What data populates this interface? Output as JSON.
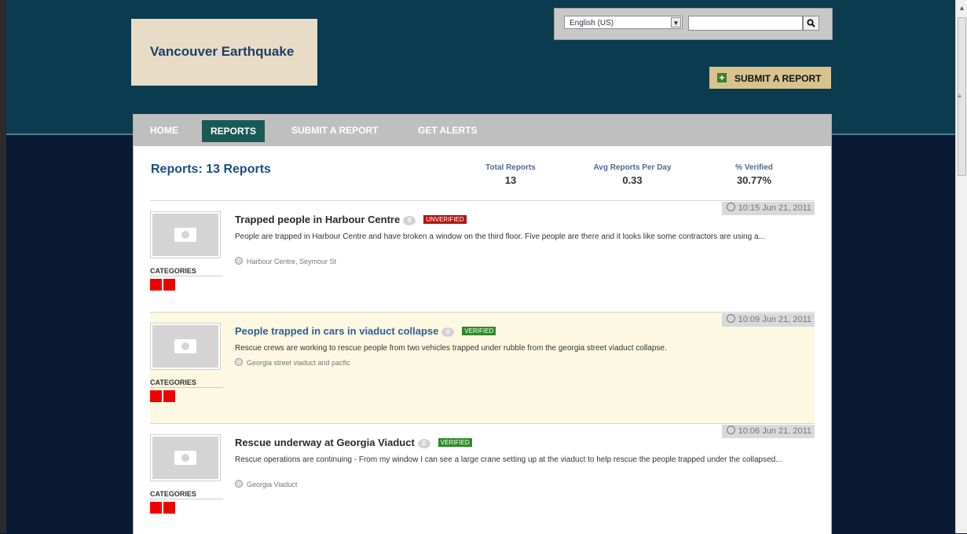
{
  "site": {
    "title": "Vancouver Earthquake"
  },
  "tools": {
    "language_selected": "English (US)",
    "search_placeholder": ""
  },
  "header_action": {
    "submit_label": "SUBMIT A REPORT"
  },
  "nav": {
    "items": [
      {
        "label": "HOME",
        "active": false
      },
      {
        "label": "REPORTS",
        "active": true
      },
      {
        "label": "SUBMIT A REPORT",
        "active": false
      },
      {
        "label": "GET ALERTS",
        "active": false
      }
    ]
  },
  "summary": {
    "title": "Reports: 13 Reports",
    "stats": [
      {
        "label": "Total Reports",
        "value": "13"
      },
      {
        "label": "Avg Reports Per Day",
        "value": "0.33"
      },
      {
        "label": "% Verified",
        "value": "30.77%"
      }
    ]
  },
  "reports": [
    {
      "title": "Trapped people in Harbour Centre",
      "comments": "0",
      "status": "UNVERIFIED",
      "timestamp": "10:15 Jun 21, 2011",
      "description": "People are trapped in Harbour Centre and have broken a window on the third floor. Five people are there and it looks like some contractors are using a...",
      "location": "Harbour Centre, Seymour St",
      "categories_label": "CATEGORIES"
    },
    {
      "title": "People trapped in cars in viaduct collapse",
      "comments": "0",
      "status": "VERIFIED",
      "timestamp": "10:09 Jun 21, 2011",
      "description": "Rescue crews are working to rescue people from two vehicles trapped under rubble from the georgia street viaduct collapse.",
      "location": "Georgia street viaduct and pacfic",
      "categories_label": "CATEGORIES"
    },
    {
      "title": "Rescue underway at Georgia Viaduct",
      "comments": "0",
      "status": "VERIFIED",
      "timestamp": "10:06 Jun 21, 2011",
      "description": "Rescue operations are continuing - From my window I can see a large crane setting up at the viaduct to help rescue the people trapped under the collapsed...",
      "location": "Georgia Viaduct",
      "categories_label": "CATEGORIES"
    }
  ],
  "colors": {
    "header_bg": "#0b3b4e",
    "page_bg": "#0b1a33",
    "logo_bg": "#e8dcc6",
    "nav_active": "#1a5a56",
    "unverified": "#b31410",
    "verified": "#2e8a26",
    "category": "#f00000"
  }
}
